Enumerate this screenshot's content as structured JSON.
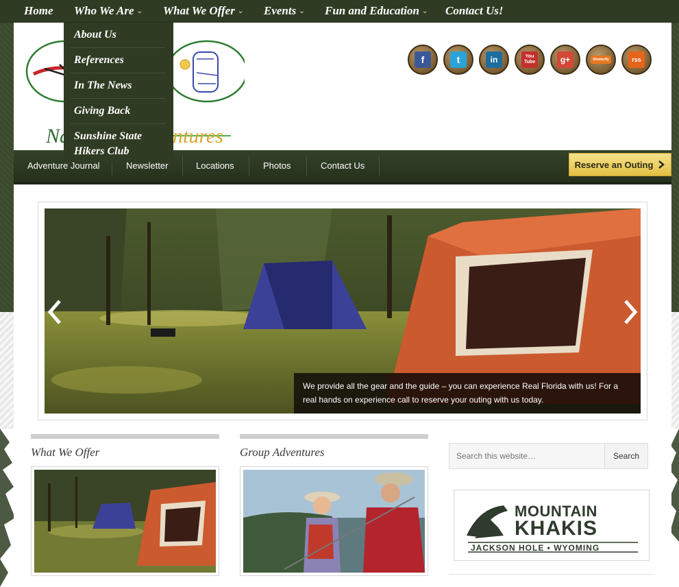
{
  "top_nav": {
    "items": [
      {
        "label": "Home",
        "has_dropdown": false
      },
      {
        "label": "Who We Are",
        "has_dropdown": true
      },
      {
        "label": "What We Offer",
        "has_dropdown": true
      },
      {
        "label": "Events",
        "has_dropdown": true
      },
      {
        "label": "Fun and Education",
        "has_dropdown": true
      },
      {
        "label": "Contact Us!",
        "has_dropdown": false
      }
    ]
  },
  "dropdown": {
    "items": [
      "About Us",
      "References",
      "In The News",
      "Giving Back",
      "Sunshine State Hikers Club"
    ]
  },
  "logo": {
    "text_left": "Na",
    "text_right": "ntures",
    "accent_green": "#2e7d32",
    "accent_gold": "#d9a62a",
    "accent_red": "#c62828"
  },
  "social": [
    {
      "icon": "facebook-icon",
      "glyph": "f",
      "color": "#3b5998"
    },
    {
      "icon": "twitter-icon",
      "glyph": "t",
      "color": "#2aa3d8"
    },
    {
      "icon": "linkedin-icon",
      "glyph": "in",
      "color": "#1d6e9e"
    },
    {
      "icon": "youtube-icon",
      "glyph": "You Tube",
      "color": "#c4302b"
    },
    {
      "icon": "google-plus-icon",
      "glyph": "g+",
      "color": "#d34836"
    },
    {
      "icon": "shutterfly-icon",
      "glyph": "Shutterfly",
      "color": "#e87722"
    },
    {
      "icon": "rss-icon",
      "glyph": "rss",
      "color": "#e8641b"
    }
  ],
  "sub_nav": {
    "items": [
      "Adventure Journal",
      "Newsletter",
      "Locations",
      "Photos",
      "Contact Us"
    ],
    "reserve_label": "Reserve an Outing"
  },
  "slider": {
    "caption": "We provide all the gear and the guide – you can experience Real Florida with us! For a real hands on experience call to reserve your outing with us today."
  },
  "columns": [
    {
      "title": "What We Offer"
    },
    {
      "title": "Group Adventures"
    }
  ],
  "sidebar": {
    "search_placeholder": "Search this website…",
    "search_button": "Search",
    "ad": {
      "line1": "MOUNTAIN",
      "line2": "KHAKIS",
      "line3": "JACKSON HOLE • WYOMING"
    }
  }
}
